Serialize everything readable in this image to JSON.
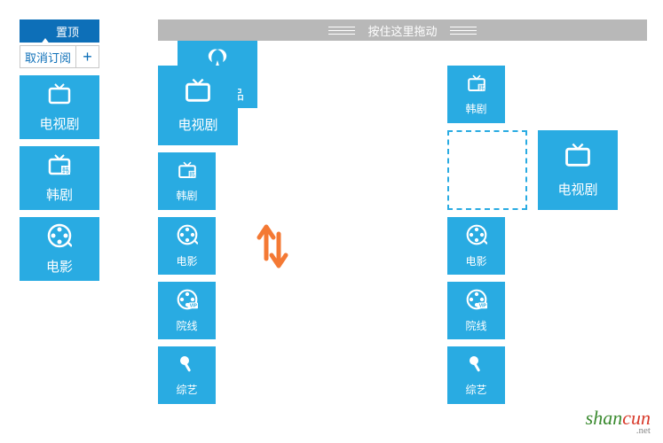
{
  "sidebar": {
    "main": {
      "label": "原创出品"
    },
    "pin": {
      "label": "置顶"
    },
    "unsubscribe": {
      "label": "取消订阅"
    },
    "add": {
      "label": "+"
    },
    "nav": [
      {
        "label": "电视剧",
        "icon": "tv-icon"
      },
      {
        "label": "韩剧",
        "icon": "korean-tv-icon"
      },
      {
        "label": "电影",
        "icon": "film-reel-icon"
      }
    ]
  },
  "drag_bar": {
    "text": "按住这里拖动"
  },
  "left_column": {
    "large": {
      "label": "电视剧",
      "icon": "tv-icon"
    },
    "small": [
      {
        "label": "韩剧",
        "icon": "korean-tv-icon"
      },
      {
        "label": "电影",
        "icon": "film-reel-icon"
      },
      {
        "label": "院线",
        "icon": "vip-reel-icon"
      },
      {
        "label": "综艺",
        "icon": "mic-icon"
      }
    ]
  },
  "right_column": {
    "top_small": {
      "label": "韩剧",
      "icon": "korean-tv-icon"
    },
    "large": {
      "label": "电视剧",
      "icon": "tv-icon"
    },
    "small": [
      {
        "label": "电影",
        "icon": "film-reel-icon"
      },
      {
        "label": "院线",
        "icon": "vip-reel-icon"
      },
      {
        "label": "综艺",
        "icon": "mic-icon"
      }
    ]
  },
  "watermark": {
    "green": "shan",
    "red": "cun",
    "suffix": ".net"
  }
}
